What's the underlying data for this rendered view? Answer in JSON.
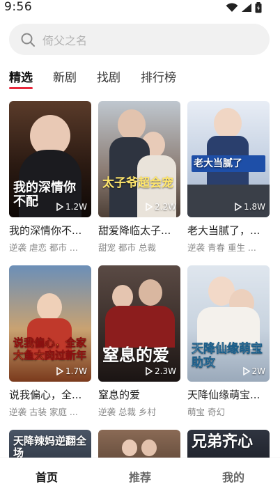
{
  "status_bar": {
    "time": "9:56"
  },
  "search": {
    "placeholder": "倚父之名"
  },
  "tabs": [
    {
      "label": "精选",
      "active": true
    },
    {
      "label": "新剧",
      "active": false
    },
    {
      "label": "找剧",
      "active": false
    },
    {
      "label": "排行榜",
      "active": false
    }
  ],
  "colors": {
    "accent": "#e8283c",
    "search_bg": "#f1f1f1"
  },
  "cards": [
    {
      "title": "我的深情你不...",
      "tags": "逆袭 虐恋 都市 ...",
      "plays": "1.2W",
      "art": "我的深情你不配"
    },
    {
      "title": "甜爱降临太子...",
      "tags": "甜宠 都市 总裁",
      "plays": "2.2W",
      "art": "太子爷超会宠"
    },
    {
      "title": "老大当腻了，...",
      "tags": "逆袭 青春 重生 ...",
      "plays": "1.8W",
      "art": "老大当腻了"
    },
    {
      "title": "说我偏心，全...",
      "tags": "逆袭 古装 家庭 ...",
      "plays": "1.7W",
      "art": "说我偏心，全家大鱼大肉过新年"
    },
    {
      "title": "窒息的爱",
      "tags": "逆袭 总裁 乡村",
      "plays": "2.3W",
      "art": "窒息的爱"
    },
    {
      "title": "天降仙缘萌宝...",
      "tags": "萌宝 奇幻",
      "plays": "2W",
      "art": "天降仙缘萌宝助攻"
    },
    {
      "title": "",
      "tags": "",
      "plays": "",
      "art": "天降辣妈逆翻全场"
    },
    {
      "title": "",
      "tags": "",
      "plays": "",
      "art": ""
    },
    {
      "title": "",
      "tags": "",
      "plays": "",
      "art": "兄弟齐心"
    }
  ],
  "bottom_nav": [
    {
      "label": "首页",
      "active": true
    },
    {
      "label": "推荐",
      "active": false
    },
    {
      "label": "我的",
      "active": false
    }
  ]
}
